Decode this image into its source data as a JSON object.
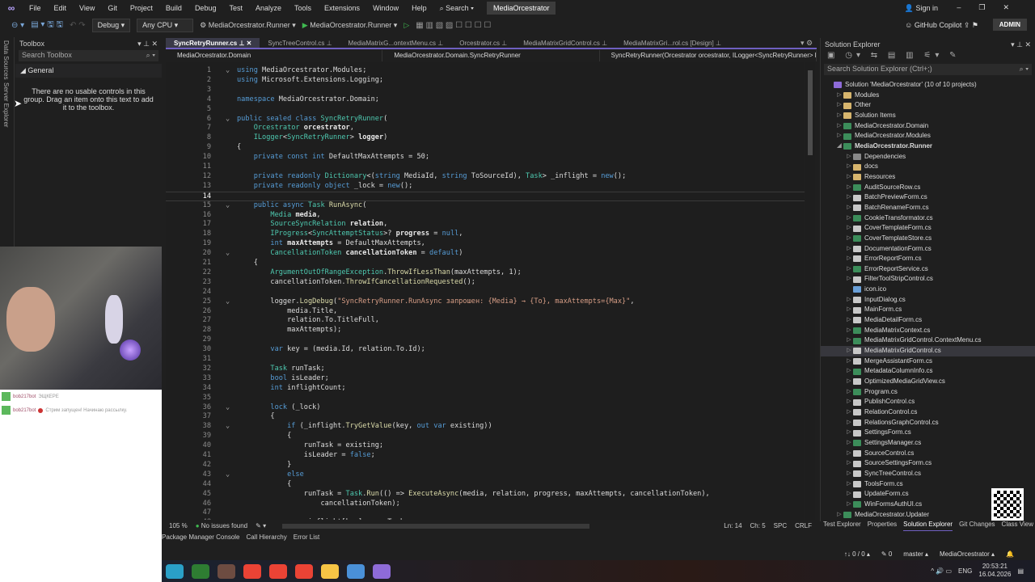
{
  "menu": {
    "items": [
      "File",
      "Edit",
      "View",
      "Git",
      "Project",
      "Build",
      "Debug",
      "Test",
      "Analyze",
      "Tools",
      "Extensions",
      "Window",
      "Help"
    ],
    "search": "Search",
    "project": "MediaOrcestrator"
  },
  "toolbar": {
    "config": "Debug",
    "platform": "Any CPU",
    "startup": "MediaOrcestrator.Runner",
    "run": "MediaOrcestrator.Runner"
  },
  "titlebar": {
    "sign_in": "Sign in",
    "copilot": "GitHub Copilot",
    "admin": "ADMIN"
  },
  "side_strip": [
    "Data Sources",
    "Server Explorer"
  ],
  "toolbox": {
    "title": "Toolbox",
    "search_placeholder": "Search Toolbox",
    "group": "General",
    "message": "There are no usable controls in this group. Drag an item onto this text to add it to the toolbox."
  },
  "chat": [
    {
      "user": "bob217bot",
      "text": "ЭЩКЕРЕ"
    },
    {
      "user": "bob217bot",
      "text": "Стрим запущен! Начинаю рассылку."
    }
  ],
  "tabs": [
    {
      "label": "SyncRetryRunner.cs",
      "active": true
    },
    {
      "label": "SyncTreeControl.cs"
    },
    {
      "label": "MediaMatrixG...ontextMenu.cs"
    },
    {
      "label": "Orcestrator.cs"
    },
    {
      "label": "MediaMatrixGridControl.cs"
    },
    {
      "label": "MediaMatrixGri...rol.cs [Design]"
    }
  ],
  "navbar": [
    "MediaOrcestrator.Domain",
    "MediaOrcestrator.Domain.SyncRetryRunner",
    "SyncRetryRunner(Orcestrator orcestrator, ILogger<SyncRetryRunner> logger)"
  ],
  "code": [
    [
      [
        "k",
        "using "
      ],
      [
        "p",
        "MediaOrcestrator.Modules;"
      ]
    ],
    [
      [
        "k",
        "using "
      ],
      [
        "p",
        "Microsoft.Extensions.Logging;"
      ]
    ],
    [],
    [
      [
        "k",
        "namespace "
      ],
      [
        "p",
        "MediaOrcestrator.Domain;"
      ]
    ],
    [],
    [
      [
        "k",
        "public sealed class "
      ],
      [
        "t",
        "SyncRetryRunner"
      ],
      [
        "p",
        "("
      ]
    ],
    [
      [
        "t",
        "    Orcestrator "
      ],
      [
        "v",
        "orcestrator"
      ],
      [
        "p",
        ","
      ]
    ],
    [
      [
        "t",
        "    ILogger"
      ],
      [
        "p",
        "<"
      ],
      [
        "t",
        "SyncRetryRunner"
      ],
      [
        "p",
        "> "
      ],
      [
        "v",
        "logger"
      ],
      [
        "p",
        ")"
      ]
    ],
    [
      [
        "p",
        "{"
      ]
    ],
    [
      [
        "k",
        "    private const int "
      ],
      [
        "p",
        "DefaultMaxAttempts = 50;"
      ]
    ],
    [],
    [
      [
        "k",
        "    private readonly "
      ],
      [
        "t",
        "Dictionary"
      ],
      [
        "p",
        "<("
      ],
      [
        "k",
        "string "
      ],
      [
        "p",
        "MediaId, "
      ],
      [
        "k",
        "string "
      ],
      [
        "p",
        "ToSourceId), "
      ],
      [
        "t",
        "Task"
      ],
      [
        "p",
        "> _inflight = "
      ],
      [
        "k",
        "new"
      ],
      [
        "p",
        "();"
      ]
    ],
    [
      [
        "k",
        "    private readonly object "
      ],
      [
        "p",
        "_lock = "
      ],
      [
        "k",
        "new"
      ],
      [
        "p",
        "();"
      ]
    ],
    [],
    [
      [
        "k",
        "    public async "
      ],
      [
        "t",
        "Task "
      ],
      [
        "m",
        "RunAsync"
      ],
      [
        "p",
        "("
      ]
    ],
    [
      [
        "t",
        "        Media "
      ],
      [
        "v",
        "media"
      ],
      [
        "p",
        ","
      ]
    ],
    [
      [
        "t",
        "        SourceSyncRelation "
      ],
      [
        "v",
        "relation"
      ],
      [
        "p",
        ","
      ]
    ],
    [
      [
        "t",
        "        IProgress"
      ],
      [
        "p",
        "<"
      ],
      [
        "t",
        "SyncAttemptStatus"
      ],
      [
        "p",
        ">? "
      ],
      [
        "v",
        "progress"
      ],
      [
        "p",
        " = "
      ],
      [
        "k",
        "null"
      ],
      [
        "p",
        ","
      ]
    ],
    [
      [
        "k",
        "        int "
      ],
      [
        "v",
        "maxAttempts"
      ],
      [
        "p",
        " = DefaultMaxAttempts,"
      ]
    ],
    [
      [
        "t",
        "        CancellationToken "
      ],
      [
        "v",
        "cancellationToken"
      ],
      [
        "p",
        " = "
      ],
      [
        "k",
        "default"
      ],
      [
        "p",
        ")"
      ]
    ],
    [
      [
        "p",
        "    {"
      ]
    ],
    [
      [
        "t",
        "        ArgumentOutOfRangeException"
      ],
      [
        "p",
        "."
      ],
      [
        "m",
        "ThrowIfLessThan"
      ],
      [
        "p",
        "(maxAttempts, 1);"
      ]
    ],
    [
      [
        "p",
        "        cancellationToken."
      ],
      [
        "m",
        "ThrowIfCancellationRequested"
      ],
      [
        "p",
        "();"
      ]
    ],
    [],
    [
      [
        "p",
        "        logger."
      ],
      [
        "m",
        "LogDebug"
      ],
      [
        "p",
        "("
      ],
      [
        "s",
        "\"SyncRetryRunner.RunAsync запрошен: {Media} → {To}, maxAttempts={Max}\""
      ],
      [
        "p",
        ","
      ]
    ],
    [
      [
        "p",
        "            media.Title,"
      ]
    ],
    [
      [
        "p",
        "            relation.To.TitleFull,"
      ]
    ],
    [
      [
        "p",
        "            maxAttempts);"
      ]
    ],
    [],
    [
      [
        "k",
        "        var "
      ],
      [
        "p",
        "key = (media.Id, relation.To.Id);"
      ]
    ],
    [],
    [
      [
        "t",
        "        Task "
      ],
      [
        "p",
        "runTask;"
      ]
    ],
    [
      [
        "k",
        "        bool "
      ],
      [
        "p",
        "isLeader;"
      ]
    ],
    [
      [
        "k",
        "        int "
      ],
      [
        "p",
        "inflightCount;"
      ]
    ],
    [],
    [
      [
        "k",
        "        lock "
      ],
      [
        "p",
        "(_lock)"
      ]
    ],
    [
      [
        "p",
        "        {"
      ]
    ],
    [
      [
        "k",
        "            if "
      ],
      [
        "p",
        "(_inflight."
      ],
      [
        "m",
        "TryGetValue"
      ],
      [
        "p",
        "(key, "
      ],
      [
        "k",
        "out var "
      ],
      [
        "p",
        "existing))"
      ]
    ],
    [
      [
        "p",
        "            {"
      ]
    ],
    [
      [
        "p",
        "                runTask = existing;"
      ]
    ],
    [
      [
        "p",
        "                isLeader = "
      ],
      [
        "k",
        "false"
      ],
      [
        "p",
        ";"
      ]
    ],
    [
      [
        "p",
        "            }"
      ]
    ],
    [
      [
        "k",
        "            else"
      ]
    ],
    [
      [
        "p",
        "            {"
      ]
    ],
    [
      [
        "p",
        "                runTask = "
      ],
      [
        "t",
        "Task"
      ],
      [
        "p",
        "."
      ],
      [
        "m",
        "Run"
      ],
      [
        "p",
        "(() => "
      ],
      [
        "m",
        "ExecuteAsync"
      ],
      [
        "p",
        "(media, relation, progress, maxAttempts, cancellationToken),"
      ]
    ],
    [
      [
        "p",
        "                    cancellationToken);"
      ]
    ],
    [],
    [
      [
        "p",
        "                _inflight[key] = runTask;"
      ]
    ]
  ],
  "folds": [
    1,
    6,
    15,
    20,
    25,
    36,
    38,
    43
  ],
  "current_line": 14,
  "editor_status": {
    "zoom": "105 %",
    "issues": "No issues found",
    "line": "Ln: 14",
    "col": "Ch: 5",
    "spacing": "SPC",
    "eol": "CRLF"
  },
  "bottom_tabs": [
    "Package Manager Console",
    "Call Hierarchy",
    "Error List"
  ],
  "solution_explorer": {
    "title": "Solution Explorer",
    "search_placeholder": "Search Solution Explorer (Ctrl+;)",
    "items": [
      {
        "label": "Solution 'MediaOrcestrator' (10 of 10 projects)",
        "lvl": 0,
        "kind": "sln"
      },
      {
        "label": "Modules",
        "lvl": 1,
        "kind": "folder"
      },
      {
        "label": "Other",
        "lvl": 1,
        "kind": "folder"
      },
      {
        "label": "Solution Items",
        "lvl": 1,
        "kind": "folder"
      },
      {
        "label": "MediaOrcestrator.Domain",
        "lvl": 1,
        "kind": "proj"
      },
      {
        "label": "MediaOrcestrator.Modules",
        "lvl": 1,
        "kind": "proj"
      },
      {
        "label": "MediaOrcestrator.Runner",
        "lvl": 1,
        "kind": "proj",
        "bold": true,
        "open": true
      },
      {
        "label": "Dependencies",
        "lvl": 2,
        "kind": "dep"
      },
      {
        "label": "docs",
        "lvl": 2,
        "kind": "folder"
      },
      {
        "label": "Resources",
        "lvl": 2,
        "kind": "folder"
      },
      {
        "label": "AuditSourceRow.cs",
        "lvl": 2,
        "kind": "cs"
      },
      {
        "label": "BatchPreviewForm.cs",
        "lvl": 2,
        "kind": "form"
      },
      {
        "label": "BatchRenameForm.cs",
        "lvl": 2,
        "kind": "form"
      },
      {
        "label": "CookieTransformator.cs",
        "lvl": 2,
        "kind": "cs"
      },
      {
        "label": "CoverTemplateForm.cs",
        "lvl": 2,
        "kind": "form"
      },
      {
        "label": "CoverTemplateStore.cs",
        "lvl": 2,
        "kind": "cs"
      },
      {
        "label": "DocumentationForm.cs",
        "lvl": 2,
        "kind": "form"
      },
      {
        "label": "ErrorReportForm.cs",
        "lvl": 2,
        "kind": "form"
      },
      {
        "label": "ErrorReportService.cs",
        "lvl": 2,
        "kind": "cs"
      },
      {
        "label": "FilterToolStripControl.cs",
        "lvl": 2,
        "kind": "form"
      },
      {
        "label": "icon.ico",
        "lvl": 2,
        "kind": "file"
      },
      {
        "label": "InputDialog.cs",
        "lvl": 2,
        "kind": "form"
      },
      {
        "label": "MainForm.cs",
        "lvl": 2,
        "kind": "form"
      },
      {
        "label": "MediaDetailForm.cs",
        "lvl": 2,
        "kind": "form"
      },
      {
        "label": "MediaMatrixContext.cs",
        "lvl": 2,
        "kind": "cs"
      },
      {
        "label": "MediaMatrixGridControl.ContextMenu.cs",
        "lvl": 2,
        "kind": "cs"
      },
      {
        "label": "MediaMatrixGridControl.cs",
        "lvl": 2,
        "kind": "form",
        "sel": true
      },
      {
        "label": "MergeAssistantForm.cs",
        "lvl": 2,
        "kind": "form"
      },
      {
        "label": "MetadataColumnInfo.cs",
        "lvl": 2,
        "kind": "cs"
      },
      {
        "label": "OptimizedMediaGridView.cs",
        "lvl": 2,
        "kind": "form"
      },
      {
        "label": "Program.cs",
        "lvl": 2,
        "kind": "cs"
      },
      {
        "label": "PublishControl.cs",
        "lvl": 2,
        "kind": "form"
      },
      {
        "label": "RelationControl.cs",
        "lvl": 2,
        "kind": "form"
      },
      {
        "label": "RelationsGraphControl.cs",
        "lvl": 2,
        "kind": "form"
      },
      {
        "label": "SettingsForm.cs",
        "lvl": 2,
        "kind": "form"
      },
      {
        "label": "SettingsManager.cs",
        "lvl": 2,
        "kind": "cs"
      },
      {
        "label": "SourceControl.cs",
        "lvl": 2,
        "kind": "form"
      },
      {
        "label": "SourceSettingsForm.cs",
        "lvl": 2,
        "kind": "form"
      },
      {
        "label": "SyncTreeControl.cs",
        "lvl": 2,
        "kind": "form"
      },
      {
        "label": "ToolsForm.cs",
        "lvl": 2,
        "kind": "form"
      },
      {
        "label": "UpdateForm.cs",
        "lvl": 2,
        "kind": "form"
      },
      {
        "label": "WinFormsAuthUI.cs",
        "lvl": 2,
        "kind": "cs"
      },
      {
        "label": "MediaOrcestrator.Updater",
        "lvl": 1,
        "kind": "proj"
      }
    ]
  },
  "se_tabs": [
    "Test Explorer",
    "Properties",
    "Solution Explorer",
    "Git Changes",
    "Class View"
  ],
  "statusbar": {
    "changes": "↑↓ 0 / 0 ▴",
    "edits": "✎ 0",
    "branch": "master ▴",
    "repo": "MediaOrcestrator ▴"
  },
  "taskbar": {
    "lang": "ENG",
    "time": "20:53:21",
    "date": "16.04.2026",
    "apps": [
      "#2aa0c8",
      "#2e7d32",
      "#6d4c41",
      "#ea4335",
      "#ea4335",
      "#ea4335",
      "#f6c445",
      "#4a90d9",
      "#8e6bd8"
    ]
  },
  "colors": {
    "accent": "#6f5fc0",
    "ok": "#3fb950"
  }
}
